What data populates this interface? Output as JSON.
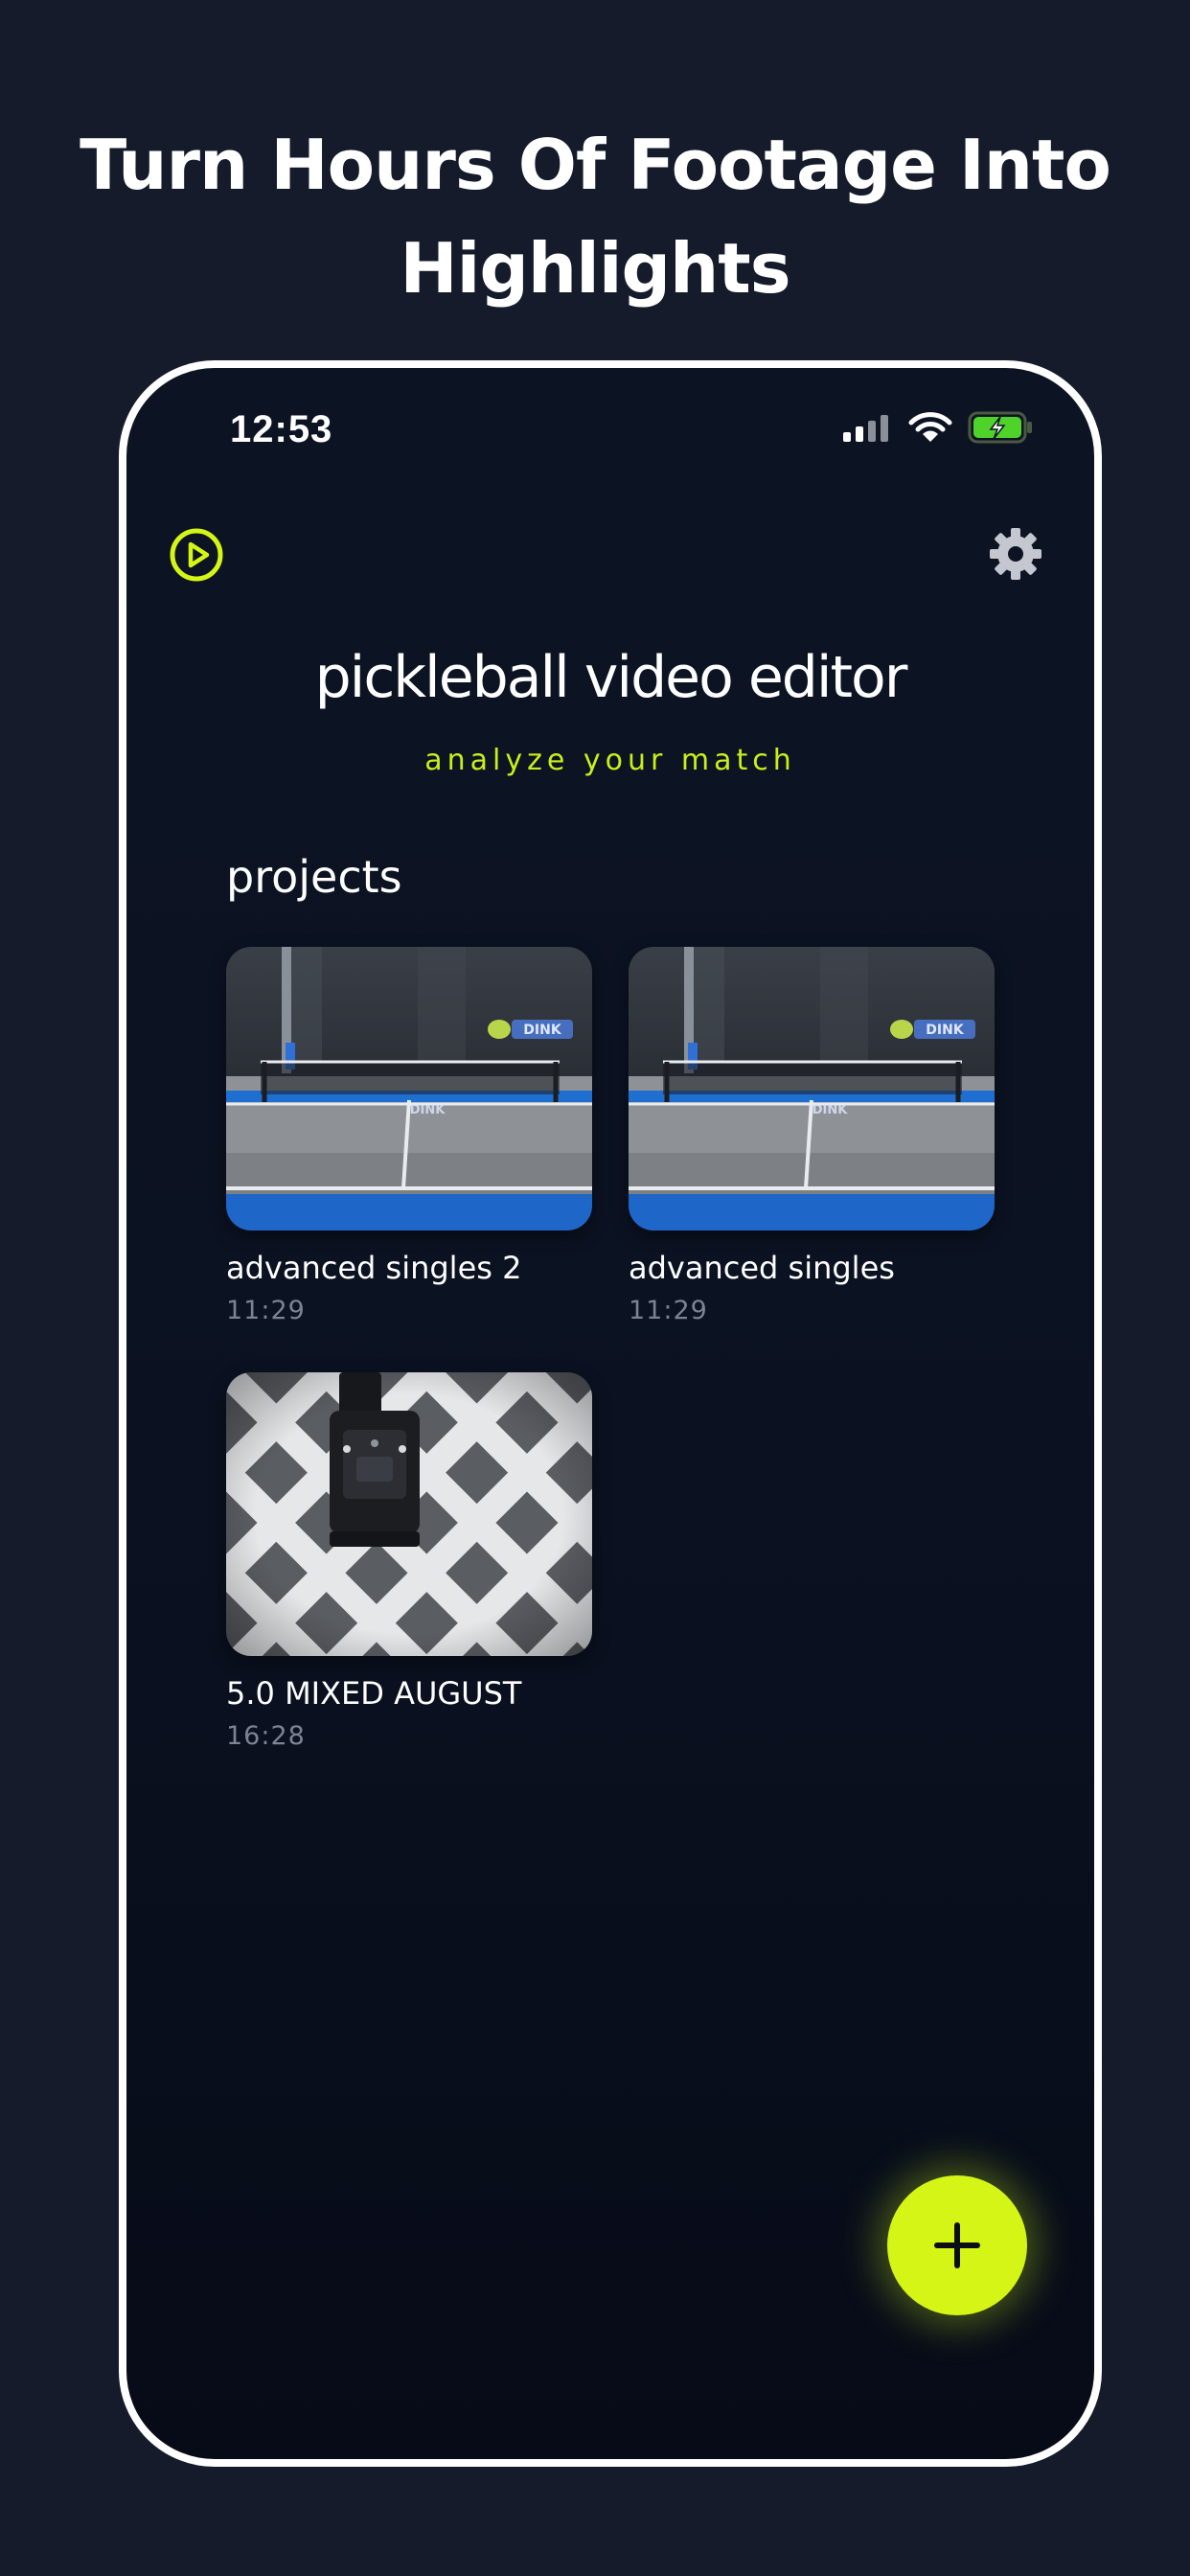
{
  "headline": {
    "line1": "Turn Hours Of Footage Into",
    "line2": "Highlights"
  },
  "status_bar": {
    "time": "12:53"
  },
  "header": {
    "play_icon": "play-circle-icon",
    "settings_icon": "gear-icon"
  },
  "app": {
    "title": "pickleball video editor",
    "subtitle": "analyze your match"
  },
  "projects": {
    "title": "projects",
    "items": [
      {
        "name": "advanced singles 2",
        "time": "11:29",
        "thumbnail": "indoor-court"
      },
      {
        "name": "advanced singles",
        "time": "11:29",
        "thumbnail": "indoor-court"
      },
      {
        "name": "5.0 MIXED AUGUST",
        "time": "16:28",
        "thumbnail": "fence-camera"
      }
    ]
  },
  "fab": {
    "icon": "plus-icon"
  },
  "colors": {
    "background": "#151b2b",
    "accent": "#d4f515",
    "screen": "#0b1121"
  }
}
